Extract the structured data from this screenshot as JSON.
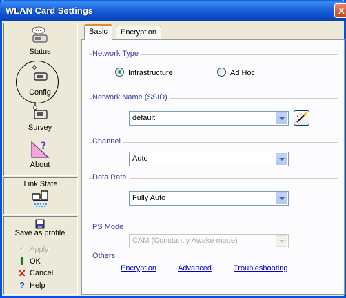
{
  "window": {
    "title": "WLAN Card Settings",
    "close_glyph": "X"
  },
  "sidebar": {
    "nav": [
      {
        "label": "Status",
        "icon": "status-icon"
      },
      {
        "label": "Config",
        "icon": "config-icon"
      },
      {
        "label": "Survey",
        "icon": "survey-icon"
      },
      {
        "label": "About",
        "icon": "about-icon"
      }
    ],
    "link_state": {
      "label": "Link State",
      "icon": "link-state-icon"
    },
    "actions": [
      {
        "label": "Save as profile",
        "icon": "save-profile-icon",
        "enabled": true
      },
      {
        "label": "Apply",
        "icon": "apply-check-icon",
        "enabled": false
      },
      {
        "label": "OK",
        "icon": "ok-icon",
        "enabled": true
      },
      {
        "label": "Cancel",
        "icon": "cancel-x-icon",
        "enabled": true
      },
      {
        "label": "Help",
        "icon": "help-question-icon",
        "enabled": true
      }
    ]
  },
  "tabs": [
    {
      "label": "Basic",
      "active": true
    },
    {
      "label": "Encryption",
      "active": false
    }
  ],
  "basic": {
    "network_type": {
      "label": "Network Type",
      "options": [
        {
          "label": "Infrastructure",
          "selected": true
        },
        {
          "label": "Ad Hoc",
          "selected": false
        }
      ]
    },
    "ssid": {
      "label": "Network Name (SSID)",
      "value": "default",
      "wand_icon": "wand-icon"
    },
    "channel": {
      "label": "Channel",
      "value": "Auto"
    },
    "data_rate": {
      "label": "Data Rate",
      "value": "Fully Auto"
    },
    "ps_mode": {
      "label": "PS Mode",
      "value": "CAM (Constantly Awake mode)",
      "enabled": false
    },
    "others": {
      "label": "Others",
      "links": [
        "Encryption",
        "Advanced",
        "Troubleshooting"
      ]
    }
  },
  "colors": {
    "title_bar": "#0a4ec8",
    "group_label": "#3d3d99",
    "link": "#0000cc",
    "tab_accent": "#e68b2c"
  }
}
